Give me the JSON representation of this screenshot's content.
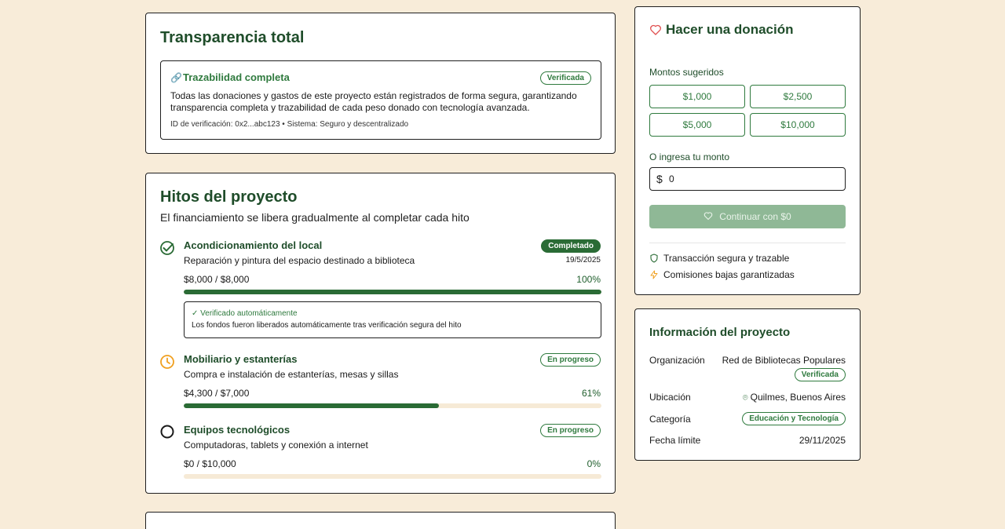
{
  "transparency": {
    "title": "Transparencia total",
    "trace_title": "Trazabilidad completa",
    "trace_badge": "Verificada",
    "trace_text_1": "Todas las donaciones y gastos de este proyecto están registrados de forma segura, garantizando",
    "trace_text_2": "transparencia completa y trazabilidad de cada peso donado con tecnología avanzada.",
    "trace_meta": "ID de verificación: 0x2...abc123 • Sistema: Seguro y descentralizado"
  },
  "milestones": {
    "title": "Hitos del proyecto",
    "subtitle": "El financiamiento se libera gradualmente al completar cada hito",
    "items": [
      {
        "title": "Acondicionamiento del local",
        "desc": "Reparación y pintura del espacio destinado a biblioteca",
        "status": "Completado",
        "date": "19/5/2025",
        "amount": "$8,000 / $8,000",
        "percent": "100%",
        "progress": 1.0,
        "verified_title": "✓ Verificado automáticamente",
        "verified_text": "Los fondos fueron liberados automáticamente tras verificación segura del hito"
      },
      {
        "title": "Mobiliario y estanterías",
        "desc": "Compra e instalación de estanterías, mesas y sillas",
        "status": "En progreso",
        "amount": "$4,300 / $7,000",
        "percent": "61%",
        "progress": 0.61
      },
      {
        "title": "Equipos tecnológicos",
        "desc": "Computadoras, tablets y conexión a internet",
        "status": "En progreso",
        "amount": "$0 / $10,000",
        "percent": "0%",
        "progress": 0.0
      }
    ]
  },
  "donation": {
    "title": "Hacer una donación",
    "suggested_label": "Montos sugeridos",
    "amounts": [
      "$1,000",
      "$2,500",
      "$5,000",
      "$10,000"
    ],
    "custom_label": "O ingresa tu monto",
    "currency_symbol": "$",
    "custom_value": "0",
    "continue_label": "Continuar con $0",
    "features": [
      "Transacción segura y trazable",
      "Comisiones bajas garantizadas"
    ]
  },
  "project_info": {
    "title": "Información del proyecto",
    "org_label": "Organización",
    "org_value": "Red de Bibliotecas Populares",
    "org_badge": "Verificada",
    "location_label": "Ubicación",
    "location_value": "Quilmes, Buenos Aires",
    "category_label": "Categoría",
    "category_value": "Educación y Tecnología",
    "deadline_label": "Fecha límite",
    "deadline_value": "29/11/2025"
  },
  "colors": {
    "background": "#f8ecd9",
    "primary_green": "#2a6b35",
    "heading_green": "#1f4d2a",
    "accent_orange": "#f0a020",
    "heart_red": "#e05050"
  }
}
